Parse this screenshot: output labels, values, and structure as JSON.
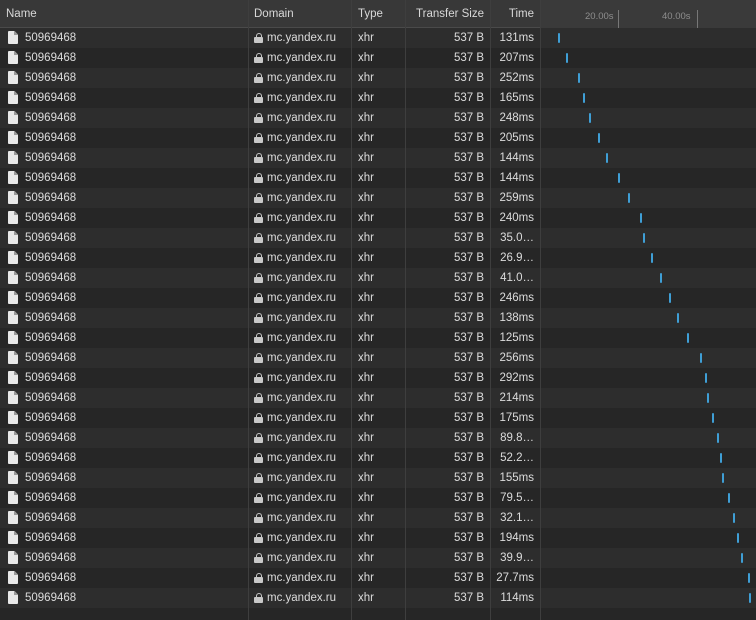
{
  "columns": {
    "name": "Name",
    "domain": "Domain",
    "type": "Type",
    "transfer_size": "Transfer Size",
    "time": "Time"
  },
  "waterfall": {
    "tick_labels": [
      "20.00s",
      "40.00s"
    ],
    "bar_color": "#3f9fd6"
  },
  "rows": [
    {
      "name": "50969468",
      "domain": "mc.yandex.ru",
      "type": "xhr",
      "size": "537 B",
      "time": "131ms",
      "start_pct": 8
    },
    {
      "name": "50969468",
      "domain": "mc.yandex.ru",
      "type": "xhr",
      "size": "537 B",
      "time": "207ms",
      "start_pct": 12
    },
    {
      "name": "50969468",
      "domain": "mc.yandex.ru",
      "type": "xhr",
      "size": "537 B",
      "time": "252ms",
      "start_pct": 17.5
    },
    {
      "name": "50969468",
      "domain": "mc.yandex.ru",
      "type": "xhr",
      "size": "537 B",
      "time": "165ms",
      "start_pct": 20
    },
    {
      "name": "50969468",
      "domain": "mc.yandex.ru",
      "type": "xhr",
      "size": "537 B",
      "time": "248ms",
      "start_pct": 22.5
    },
    {
      "name": "50969468",
      "domain": "mc.yandex.ru",
      "type": "xhr",
      "size": "537 B",
      "time": "205ms",
      "start_pct": 27
    },
    {
      "name": "50969468",
      "domain": "mc.yandex.ru",
      "type": "xhr",
      "size": "537 B",
      "time": "144ms",
      "start_pct": 30.5
    },
    {
      "name": "50969468",
      "domain": "mc.yandex.ru",
      "type": "xhr",
      "size": "537 B",
      "time": "144ms",
      "start_pct": 36.5
    },
    {
      "name": "50969468",
      "domain": "mc.yandex.ru",
      "type": "xhr",
      "size": "537 B",
      "time": "259ms",
      "start_pct": 41
    },
    {
      "name": "50969468",
      "domain": "mc.yandex.ru",
      "type": "xhr",
      "size": "537 B",
      "time": "240ms",
      "start_pct": 46.5
    },
    {
      "name": "50969468",
      "domain": "mc.yandex.ru",
      "type": "xhr",
      "size": "537 B",
      "time": "35.0…",
      "start_pct": 48
    },
    {
      "name": "50969468",
      "domain": "mc.yandex.ru",
      "type": "xhr",
      "size": "537 B",
      "time": "26.9…",
      "start_pct": 52
    },
    {
      "name": "50969468",
      "domain": "mc.yandex.ru",
      "type": "xhr",
      "size": "537 B",
      "time": "41.0…",
      "start_pct": 56
    },
    {
      "name": "50969468",
      "domain": "mc.yandex.ru",
      "type": "xhr",
      "size": "537 B",
      "time": "246ms",
      "start_pct": 60.5
    },
    {
      "name": "50969468",
      "domain": "mc.yandex.ru",
      "type": "xhr",
      "size": "537 B",
      "time": "138ms",
      "start_pct": 64
    },
    {
      "name": "50969468",
      "domain": "mc.yandex.ru",
      "type": "xhr",
      "size": "537 B",
      "time": "125ms",
      "start_pct": 69
    },
    {
      "name": "50969468",
      "domain": "mc.yandex.ru",
      "type": "xhr",
      "size": "537 B",
      "time": "256ms",
      "start_pct": 75
    },
    {
      "name": "50969468",
      "domain": "mc.yandex.ru",
      "type": "xhr",
      "size": "537 B",
      "time": "292ms",
      "start_pct": 77.5
    },
    {
      "name": "50969468",
      "domain": "mc.yandex.ru",
      "type": "xhr",
      "size": "537 B",
      "time": "214ms",
      "start_pct": 78.5
    },
    {
      "name": "50969468",
      "domain": "mc.yandex.ru",
      "type": "xhr",
      "size": "537 B",
      "time": "175ms",
      "start_pct": 80.5
    },
    {
      "name": "50969468",
      "domain": "mc.yandex.ru",
      "type": "xhr",
      "size": "537 B",
      "time": "89.8…",
      "start_pct": 83
    },
    {
      "name": "50969468",
      "domain": "mc.yandex.ru",
      "type": "xhr",
      "size": "537 B",
      "time": "52.2…",
      "start_pct": 84.5
    },
    {
      "name": "50969468",
      "domain": "mc.yandex.ru",
      "type": "xhr",
      "size": "537 B",
      "time": "155ms",
      "start_pct": 85.5
    },
    {
      "name": "50969468",
      "domain": "mc.yandex.ru",
      "type": "xhr",
      "size": "537 B",
      "time": "79.5…",
      "start_pct": 88
    },
    {
      "name": "50969468",
      "domain": "mc.yandex.ru",
      "type": "xhr",
      "size": "537 B",
      "time": "32.1…",
      "start_pct": 90.5
    },
    {
      "name": "50969468",
      "domain": "mc.yandex.ru",
      "type": "xhr",
      "size": "537 B",
      "time": "194ms",
      "start_pct": 92.5
    },
    {
      "name": "50969468",
      "domain": "mc.yandex.ru",
      "type": "xhr",
      "size": "537 B",
      "time": "39.9…",
      "start_pct": 94.5
    },
    {
      "name": "50969468",
      "domain": "mc.yandex.ru",
      "type": "xhr",
      "size": "537 B",
      "time": "27.7ms",
      "start_pct": 97.5
    },
    {
      "name": "50969468",
      "domain": "mc.yandex.ru",
      "type": "xhr",
      "size": "537 B",
      "time": "114ms",
      "start_pct": 98
    }
  ]
}
